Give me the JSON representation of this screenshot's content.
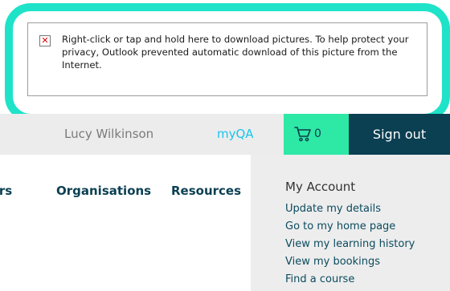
{
  "blocked_image": {
    "icon": "broken-image-x-icon",
    "message": "Right-click or tap and hold here to download pictures. To help protect your privacy, Outlook prevented automatic download of this picture from the Internet."
  },
  "header": {
    "user_name": "Lucy Wilkinson",
    "myqa_label": "myQA",
    "basket_icon": "shopping-cart-icon",
    "basket_count": "0",
    "signout_label": "Sign out"
  },
  "nav": {
    "items": [
      {
        "label": "ners"
      },
      {
        "label": "Organisations"
      },
      {
        "label": "Resources"
      }
    ]
  },
  "account_menu": {
    "title": "My Account",
    "links": [
      {
        "label": "Update my details"
      },
      {
        "label": "Go to my home page"
      },
      {
        "label": "View my learning history"
      },
      {
        "label": "View my bookings"
      },
      {
        "label": "Find a course"
      }
    ]
  },
  "colors": {
    "callout_border": "#1ee3c8",
    "topbar_bg": "#ececec",
    "myqa": "#19c5ee",
    "basket_bg": "#2ee8a6",
    "signout_bg": "#0b3f52",
    "nav_text": "#0b3f52",
    "panel_bg": "#ededed"
  }
}
